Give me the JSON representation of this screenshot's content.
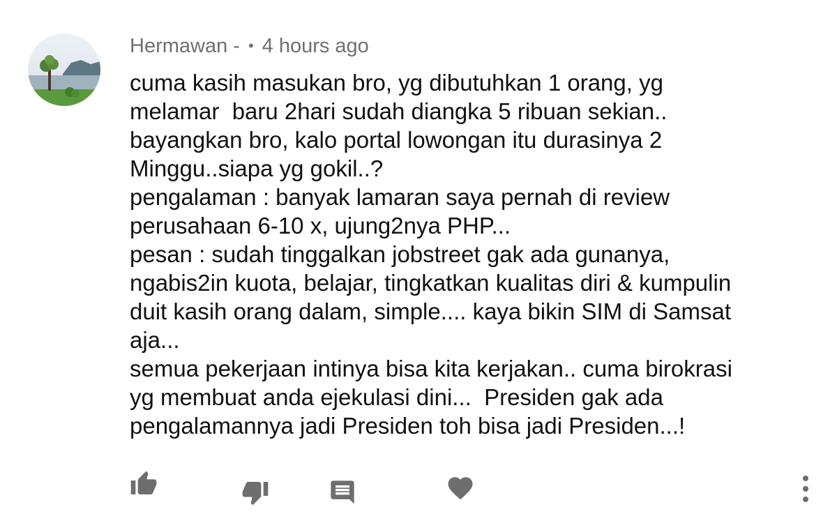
{
  "comment": {
    "author": "Hermawan -",
    "separator": "•",
    "timestamp": "4 hours ago",
    "text": "cuma kasih masukan bro, yg dibutuhkan 1 orang, yg\nmelamar  baru 2hari sudah diangka 5 ribuan sekian..\nbayangkan bro, kalo portal lowongan itu durasinya 2\nMinggu..siapa yg gokil..?\npengalaman : banyak lamaran saya pernah di review\nperusahaan 6-10 x, ujung2nya PHP...\npesan : sudah tinggalkan jobstreet gak ada gunanya,\nngabis2in kuota, belajar, tingkatkan kualitas diri & kumpulin\nduit kasih orang dalam, simple.... kaya bikin SIM di Samsat\naja...\nsemua pekerjaan intinya bisa kita kerjakan.. cuma birokrasi\nyg membuat anda ejekulasi dini...  Presiden gak ada\npengalamannya jadi Presiden toh bisa jadi Presiden...!"
  },
  "actions": {
    "icons": [
      "thumbs-up-icon",
      "thumbs-down-icon",
      "reply-icon",
      "heart-icon",
      "more-vertical-icon"
    ],
    "icon_color": "#6e6e6e"
  },
  "avatar": {
    "description_icon": "landscape-avatar",
    "colors": [
      "#dfe7ee",
      "#6f8a98",
      "#4f8f3a"
    ]
  }
}
